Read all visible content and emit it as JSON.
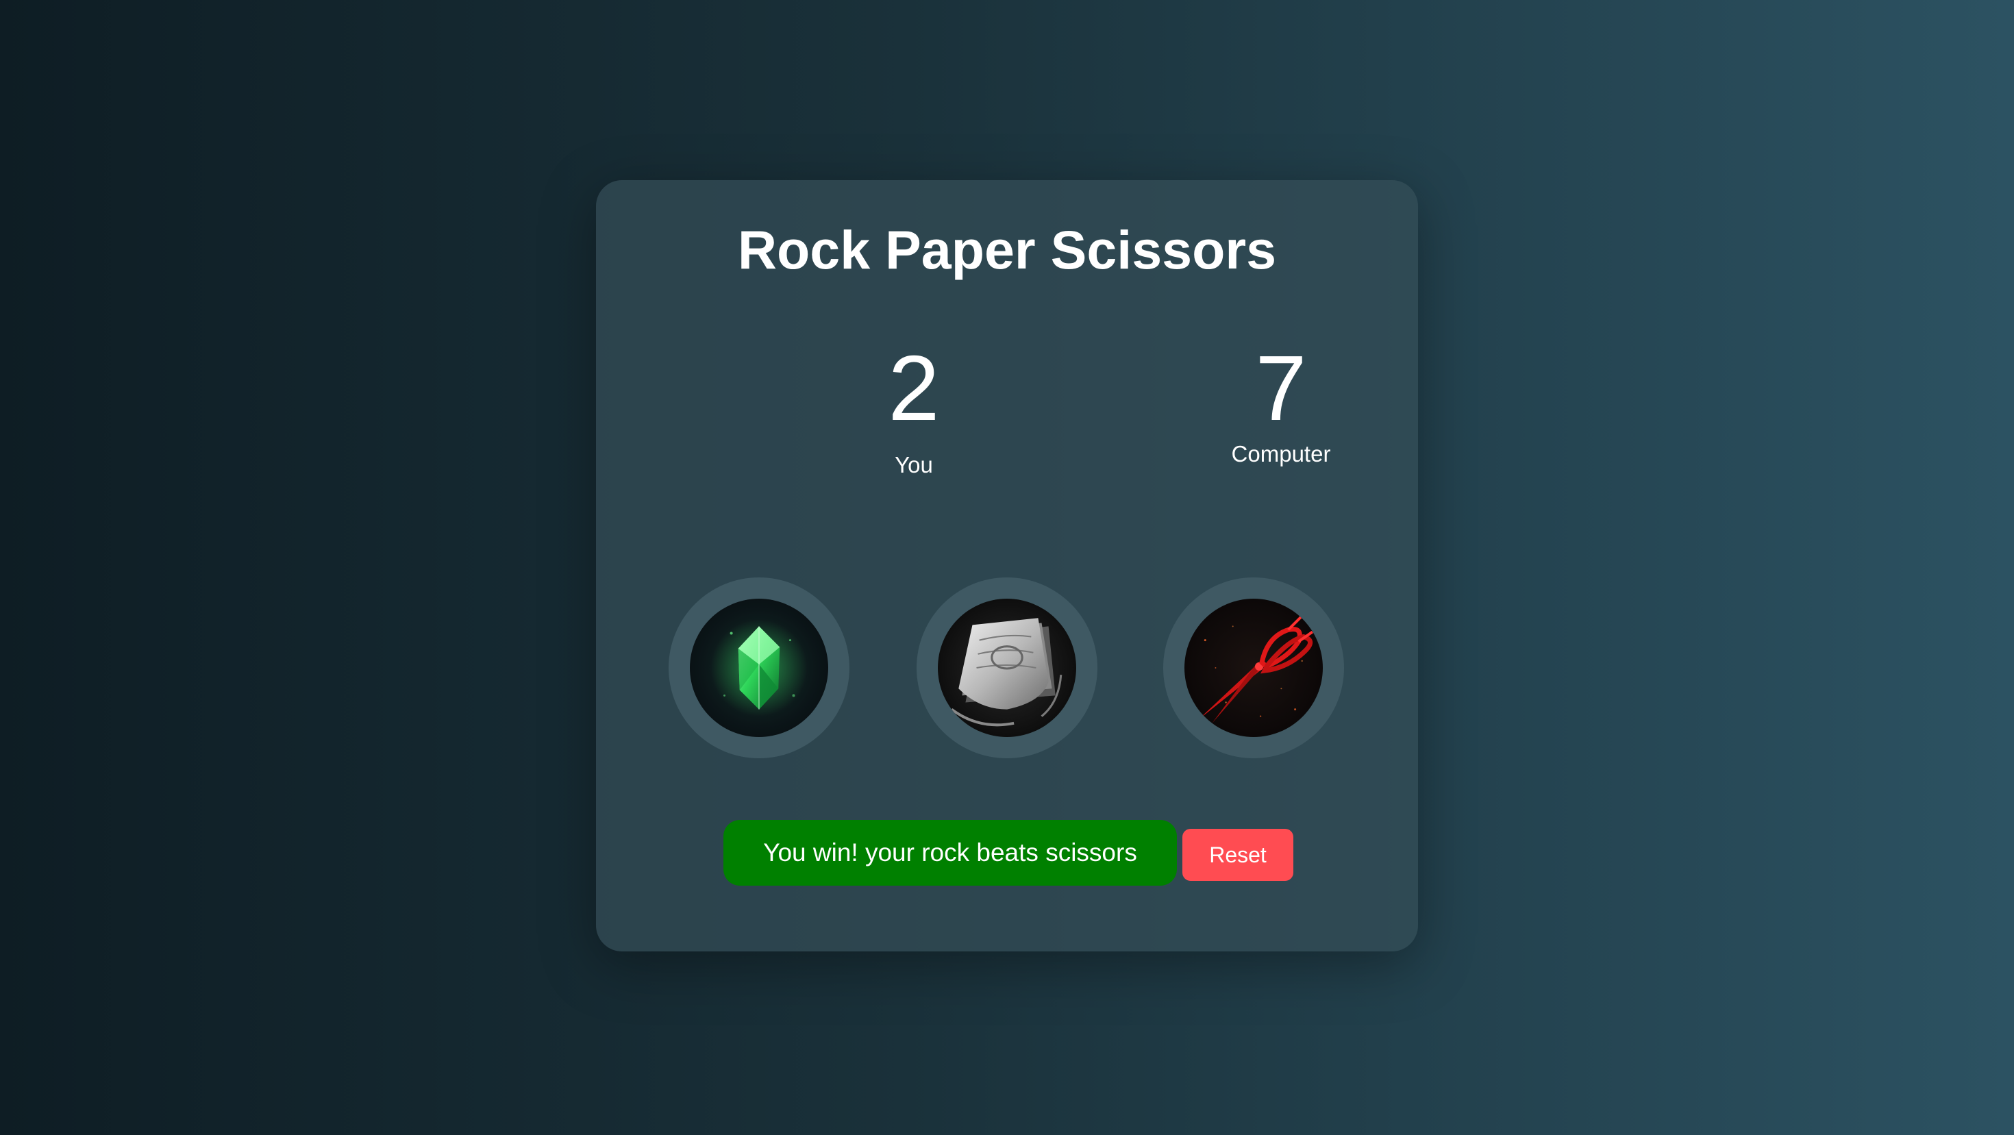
{
  "game": {
    "title": "Rock Paper Scissors"
  },
  "scores": {
    "player": {
      "value": "2",
      "label": "You"
    },
    "computer": {
      "value": "7",
      "label": "Computer"
    }
  },
  "choices": [
    {
      "id": "rock",
      "icon": "green-crystal-rock-icon"
    },
    {
      "id": "paper",
      "icon": "paper-stack-icon"
    },
    {
      "id": "scissors",
      "icon": "red-scissors-icon"
    }
  ],
  "result": {
    "message": "You win! your rock beats scissors",
    "color": "#008000"
  },
  "controls": {
    "reset_label": "Reset",
    "reset_color": "#ff4c52"
  }
}
